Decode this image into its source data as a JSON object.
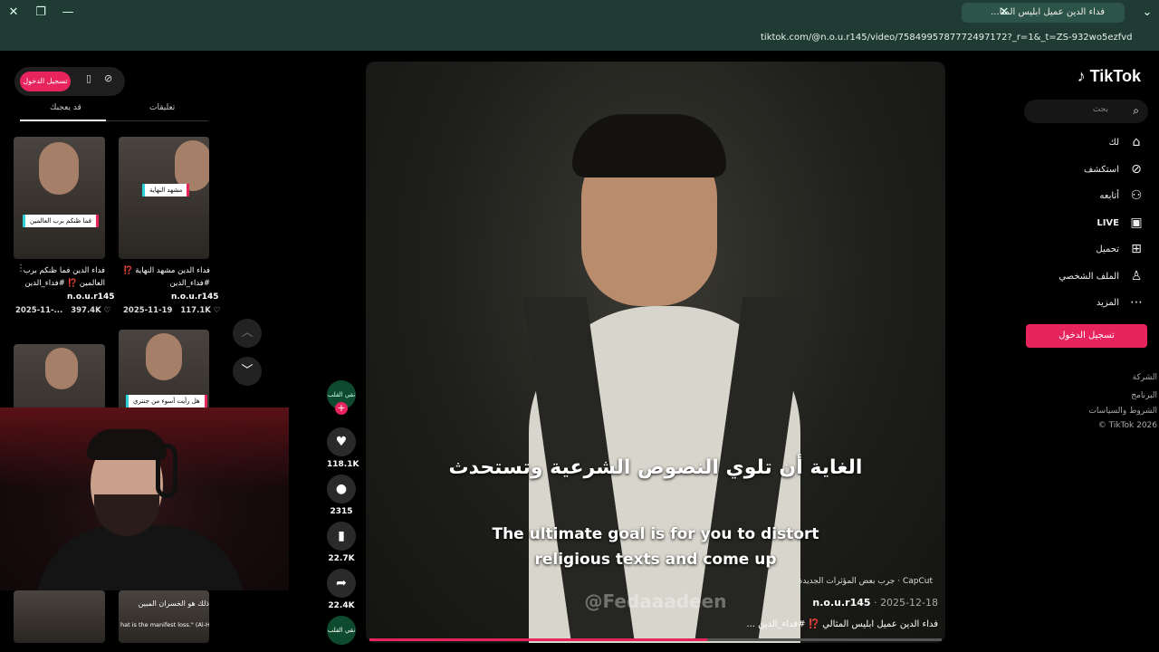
{
  "browser": {
    "tab_title": "فداء الدين عميل ابليس المثا...",
    "url": "tiktok.com/@n.o.u.r145/video/7584995787772497172?_r=1&_t=ZS-932wo5ezfvd"
  },
  "nav": {
    "logo": "TikTok",
    "search_placeholder": "بحث",
    "items": [
      {
        "label": "لك",
        "icon": "home-icon"
      },
      {
        "label": "استكشف",
        "icon": "compass-icon"
      },
      {
        "label": "أتابعه",
        "icon": "following-icon"
      },
      {
        "label": "LIVE",
        "icon": "live-icon"
      },
      {
        "label": "تحميل",
        "icon": "upload-icon"
      },
      {
        "label": "الملف الشخصي",
        "icon": "profile-icon"
      },
      {
        "label": "المزيد",
        "icon": "more-icon"
      }
    ],
    "login_button": "تسجيل الدخول",
    "footer": [
      "الشركة",
      "البرنامج",
      "الشروط والسياسات",
      "© TikTok 2026"
    ]
  },
  "video": {
    "subtitle_ar": "الغاية أن تلوي النصوص الشرعية وتستحدث",
    "subtitle_en_1": "The ultimate goal is for you to distort",
    "subtitle_en_2": "religious texts and come up",
    "watermark": "@Fedaaadeen",
    "capcut_text": "CapCut · جرب بعض المؤثرات الجديدة",
    "author": "n.o.u.r145",
    "date": "2025-12-18",
    "caption": "فداء الدين عميل ابليس المثالي ⁉️ #فداء_الدين ...",
    "progress": 0.59
  },
  "actions": {
    "avatar_text": "نقي القلب",
    "likes": "118.1K",
    "comments": "2315",
    "saves": "22.7K",
    "shares": "22.4K"
  },
  "side_panel": {
    "login_button": "تسجيل الدخول",
    "tabs": [
      "قد يعجبك",
      "تعليقات"
    ],
    "cards": [
      {
        "overlay": "فما ظنكم برب العالمين",
        "title": "فداء الدين فما ظنكم برب العالمين ⁉️ #فداء_الدين",
        "user": "n.o.u.r145",
        "date": "2025-11-...",
        "likes": "397.4K"
      },
      {
        "overlay": "مشهد النهاية",
        "title": "فداء الدين مشهد النهاية ⁉️ #فداء_الدين",
        "user": "n.o.u.r145",
        "date": "2025-11-19",
        "likes": "117.1K"
      },
      {
        "overlay": "",
        "title": "",
        "user": "",
        "date": "",
        "likes": ""
      },
      {
        "overlay": "هل رأيت أسوء من جنتري",
        "title": "",
        "user": "",
        "date": "",
        "likes": ""
      }
    ],
    "bottom_caption_1": "ذلك هو الخسران المبين",
    "bottom_caption_2": "hat is the manifest loss.\" (Al-Hajj:1"
  },
  "colors": {
    "accent": "#e8245d",
    "chrome": "#1f3b33"
  }
}
